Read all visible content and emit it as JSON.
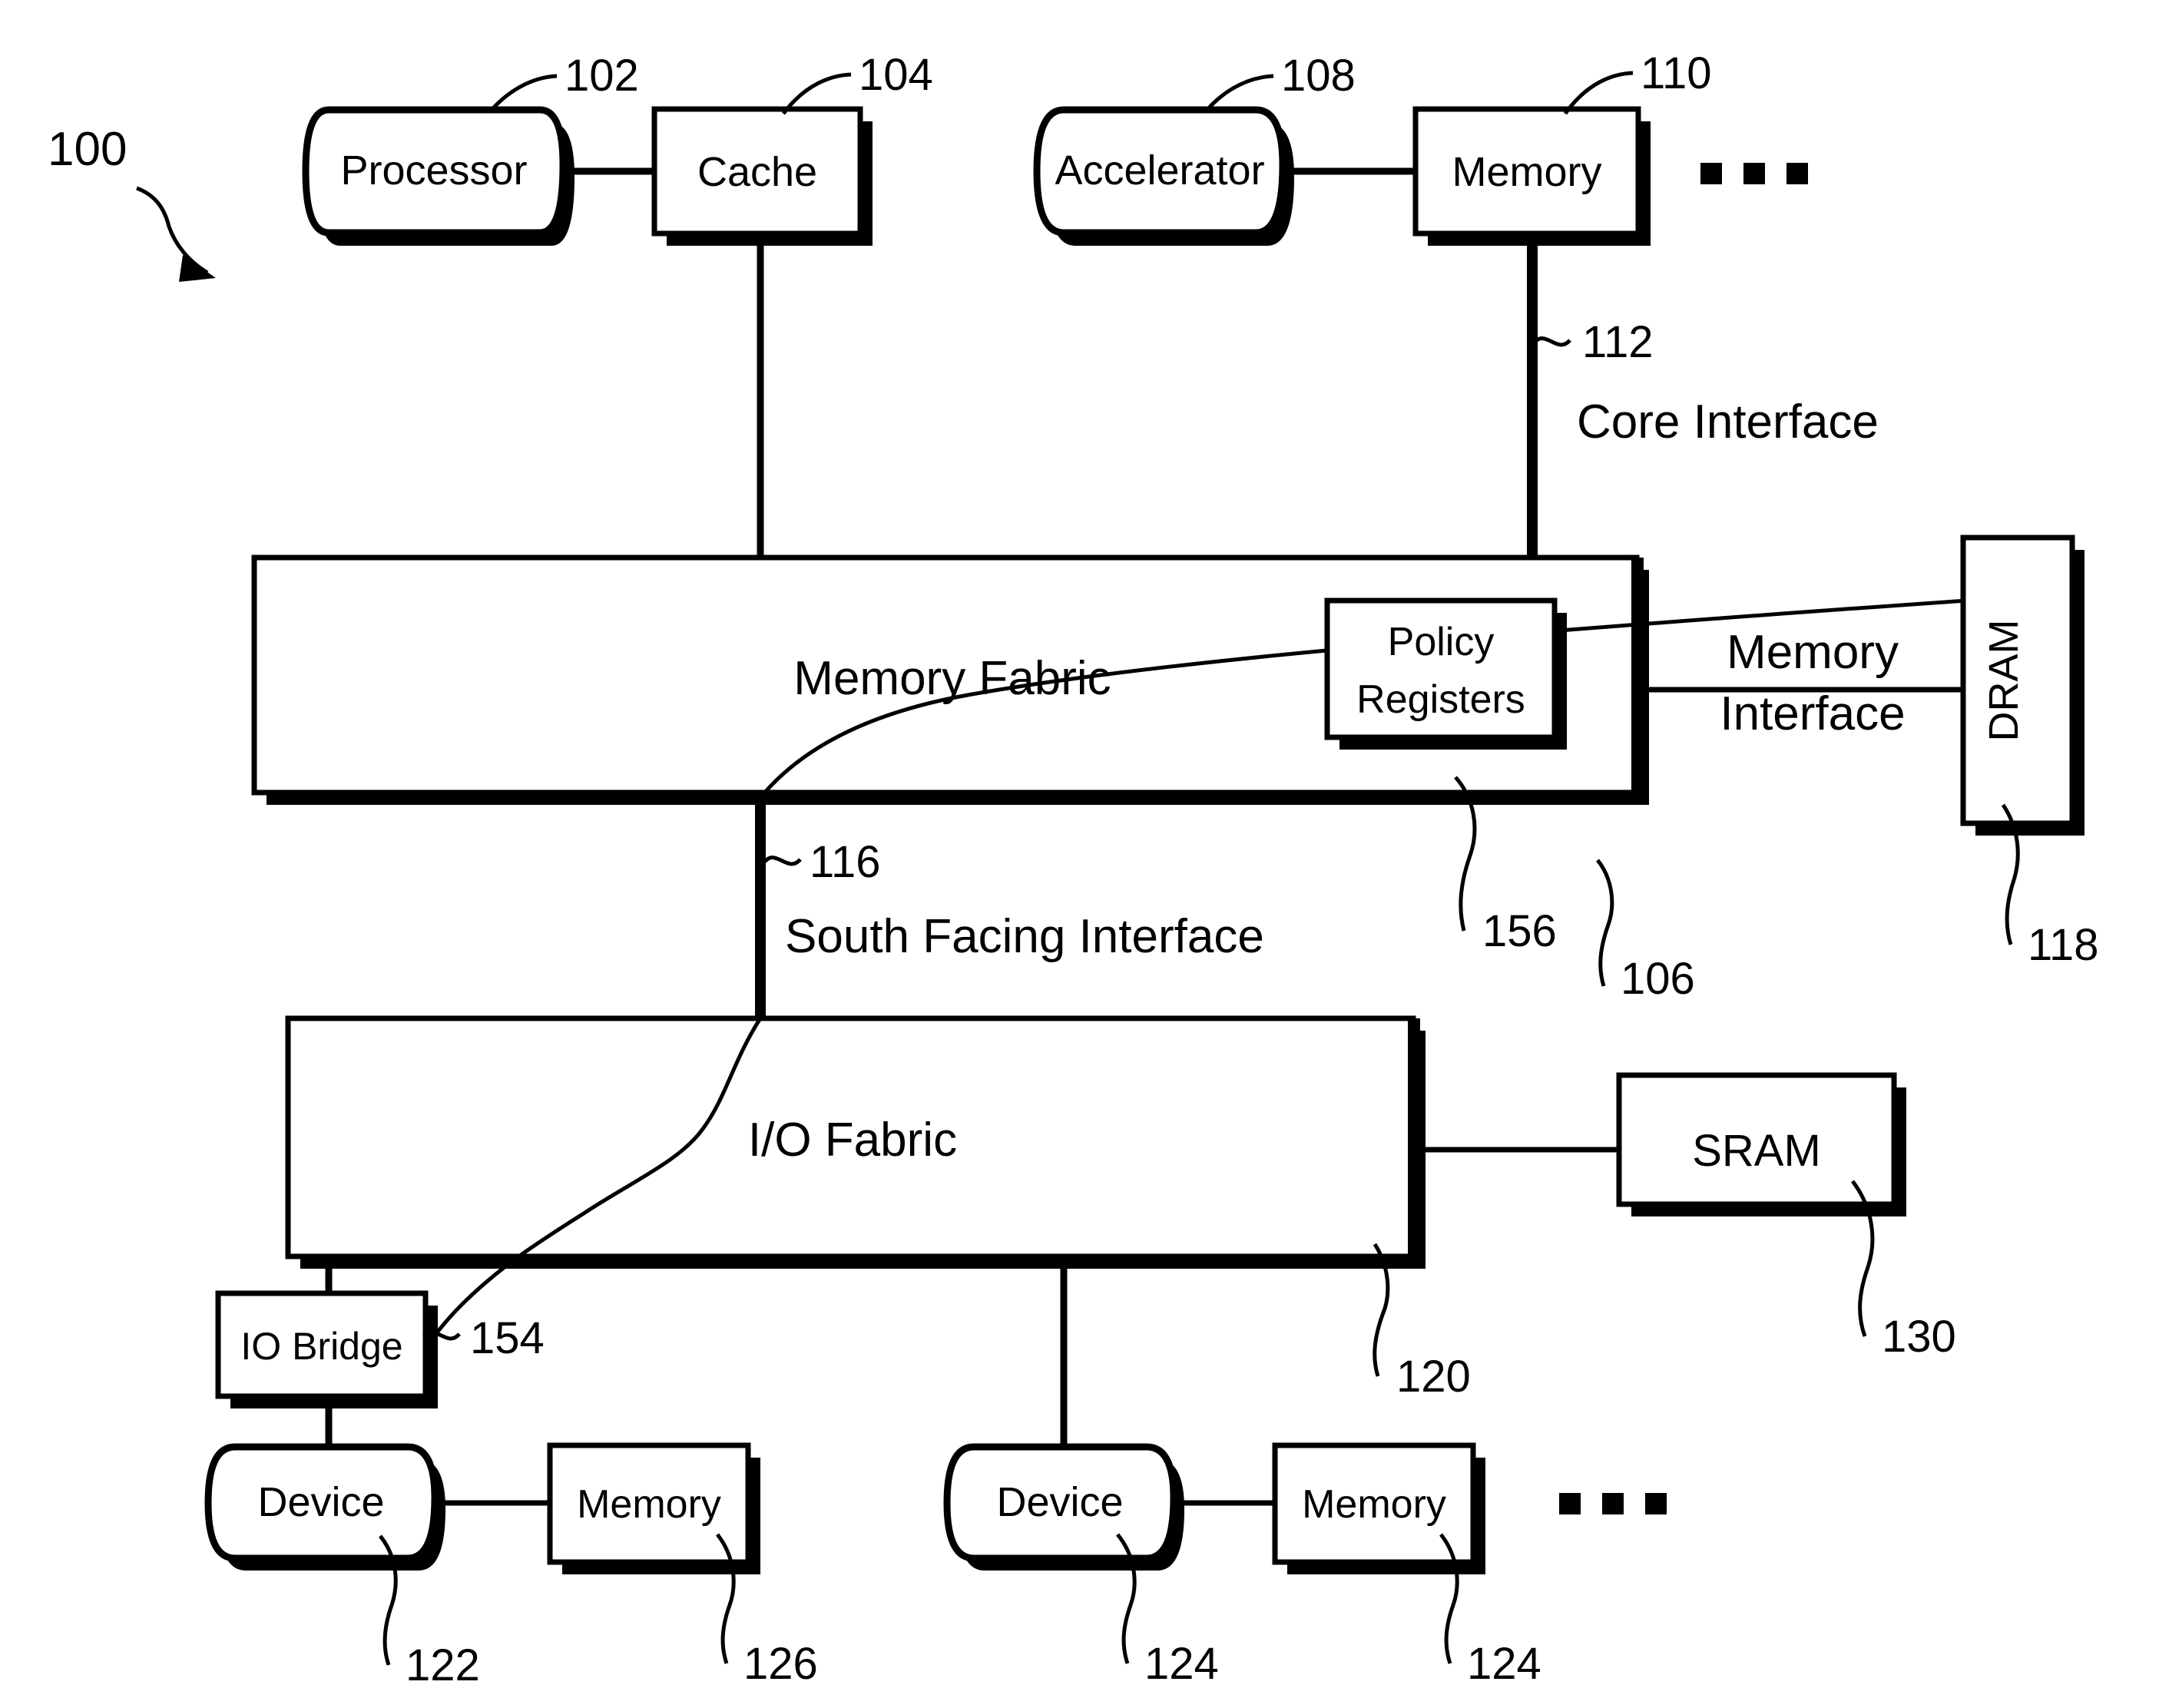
{
  "figure": {
    "id": "100",
    "type": "patent-block-diagram",
    "title": "Memory fabric system block diagram"
  },
  "blocks": {
    "processor": {
      "label": "Processor",
      "ref": "102",
      "shape": "stadium"
    },
    "cache": {
      "label": "Cache",
      "ref": "104",
      "shape": "rect"
    },
    "accelerator": {
      "label": "Accelerator",
      "ref": "108",
      "shape": "stadium"
    },
    "core_memory": {
      "label": "Memory",
      "ref": "110",
      "shape": "rect"
    },
    "memory_fabric": {
      "label": "Memory Fabric",
      "ref": "106",
      "shape": "rect"
    },
    "policy_registers": {
      "label_line1": "Policy",
      "label_line2": "Registers",
      "label": "Policy Registers",
      "ref": "156",
      "shape": "rect"
    },
    "dram": {
      "label": "DRAM",
      "ref": "118",
      "shape": "rect-vertical-text"
    },
    "io_fabric": {
      "label": "I/O Fabric",
      "ref": "120",
      "shape": "rect"
    },
    "sram": {
      "label": "SRAM",
      "ref": "130",
      "shape": "rect"
    },
    "io_bridge": {
      "label": "IO Bridge",
      "ref": "154",
      "shape": "rect"
    },
    "device_1": {
      "label": "Device",
      "ref": "122",
      "shape": "stadium"
    },
    "device_1_memory": {
      "label": "Memory",
      "ref": "126",
      "shape": "rect"
    },
    "device_2": {
      "label": "Device",
      "ref": "124",
      "shape": "stadium"
    },
    "device_2_memory": {
      "label": "Memory",
      "ref": "124",
      "shape": "rect"
    }
  },
  "interface_labels": {
    "core_interface": {
      "label": "Core Interface",
      "ref": "112"
    },
    "south_facing": {
      "label": "South Facing Interface",
      "ref": "116"
    },
    "memory_interface": {
      "label_line1": "Memory",
      "label_line2": "Interface",
      "label": "Memory Interface"
    }
  },
  "ellipses": {
    "top_row": "▪ ▪ ▪",
    "bottom_row": "▪ ▪ ▪"
  },
  "colors": {
    "stroke": "#000000",
    "fill": "#ffffff",
    "shadow": "#000000"
  }
}
